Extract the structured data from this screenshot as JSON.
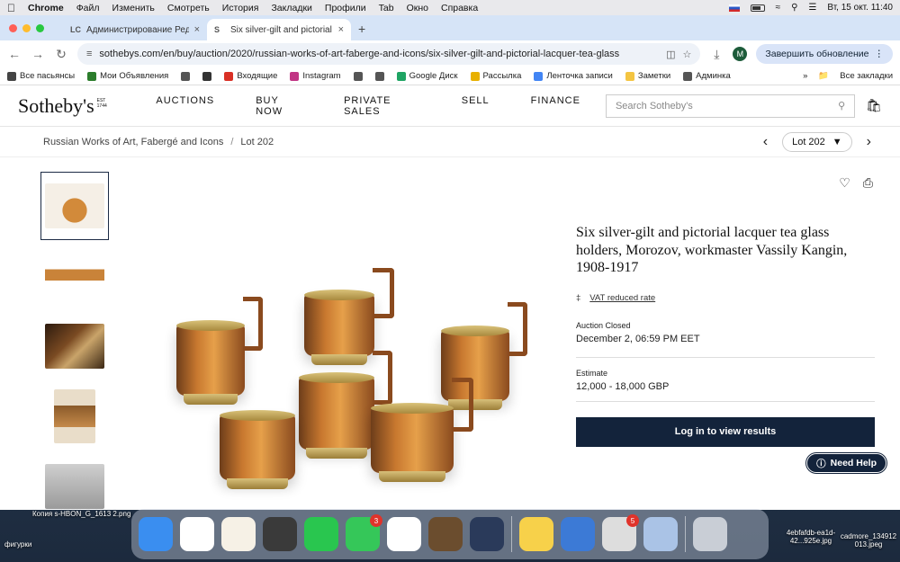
{
  "menubar": {
    "app": "Chrome",
    "items": [
      "Файл",
      "Изменить",
      "Смотреть",
      "История",
      "Закладки",
      "Профили",
      "Tab",
      "Окно",
      "Справка"
    ],
    "datetime": "Вт, 15 окт.  11:40"
  },
  "tabs": [
    {
      "favicon": "LC",
      "title": "Администрирование Редакт"
    },
    {
      "favicon": "S",
      "title": "Six silver-gilt and pictorial lac"
    }
  ],
  "toolbar": {
    "url": "sothebys.com/en/buy/auction/2020/russian-works-of-art-faberge-and-icons/six-silver-gilt-and-pictorial-lacquer-tea-glass",
    "profile_initial": "M",
    "update_label": "Завершить обновление"
  },
  "bookmarks": [
    {
      "label": "Все пасьянсы",
      "icon": "card-icon",
      "color": "#444"
    },
    {
      "label": "Мои Объявления",
      "icon": "ss-icon",
      "color": "#2c7d2c"
    },
    {
      "label": "",
      "icon": "globe-icon",
      "color": "#555"
    },
    {
      "label": "",
      "icon": "spade-icon",
      "color": "#333"
    },
    {
      "label": "Входящие",
      "icon": "gmail-icon",
      "color": "#d93025"
    },
    {
      "label": "Instagram",
      "icon": "instagram-icon",
      "color": "#c13584"
    },
    {
      "label": "",
      "icon": "globe-icon",
      "color": "#555"
    },
    {
      "label": "",
      "icon": "globe-icon",
      "color": "#555"
    },
    {
      "label": "Google Диск",
      "icon": "drive-icon",
      "color": "#1fa463"
    },
    {
      "label": "Рассылка",
      "icon": "mail-icon",
      "color": "#e8b000"
    },
    {
      "label": "Ленточка записи",
      "icon": "doc-icon",
      "color": "#4285f4"
    },
    {
      "label": "Заметки",
      "icon": "notes-icon",
      "color": "#f4c542"
    },
    {
      "label": "Админка",
      "icon": "lc-icon",
      "color": "#555"
    }
  ],
  "bookmarks_all": "Все закладки",
  "site": {
    "logo": "Sotheby's",
    "logo_est": "EST 1744",
    "nav": [
      "AUCTIONS",
      "BUY NOW",
      "PRIVATE SALES",
      "SELL",
      "FINANCE"
    ],
    "search_placeholder": "Search Sotheby's"
  },
  "breadcrumb": {
    "parent": "Russian Works of Art, Fabergé and Icons",
    "current": "Lot 202"
  },
  "lot_selector": "Lot 202",
  "lot": {
    "title": "Six silver-gilt and pictorial lacquer tea glass holders, Morozov, workmaster Vassily Kangin, 1908-1917",
    "vat_link": "VAT reduced rate",
    "status_label": "Auction Closed",
    "status_value": "December 2, 06:59 PM EET",
    "estimate_label": "Estimate",
    "estimate_value": "12,000 - 18,000 GBP",
    "cta": "Log in to view results"
  },
  "help_label": "Need Help",
  "dock": [
    {
      "name": "finder-icon",
      "color": "#3a8ef0",
      "badge": ""
    },
    {
      "name": "chrome-icon",
      "color": "#ffffff",
      "badge": ""
    },
    {
      "name": "pages-icon",
      "color": "#f6f1e6",
      "badge": ""
    },
    {
      "name": "calculator-icon",
      "color": "#3a3a3a",
      "badge": ""
    },
    {
      "name": "whatsapp-icon",
      "color": "#29c64f",
      "badge": ""
    },
    {
      "name": "messages-icon",
      "color": "#35c759",
      "badge": "3"
    },
    {
      "name": "photos-icon",
      "color": "#ffffff",
      "badge": ""
    },
    {
      "name": "figurine-icon",
      "color": "#6b4d2e",
      "badge": ""
    },
    {
      "name": "helmet-icon",
      "color": "#2a3a5a",
      "badge": ""
    },
    {
      "name": "notes-icon",
      "color": "#f7d14a",
      "badge": ""
    },
    {
      "name": "network-icon",
      "color": "#3c7ad6",
      "badge": ""
    },
    {
      "name": "printer-icon",
      "color": "#dddddd",
      "badge": "5"
    },
    {
      "name": "preview-icon",
      "color": "#aac3e6",
      "badge": ""
    },
    {
      "name": "trash-icon",
      "color": "#c9ced6",
      "badge": ""
    }
  ],
  "desktop_labels": {
    "left_top": "Копия s-HBON_G_1613 2.png",
    "left_bottom": "фигурки",
    "right_a": "4ebfafdb-ea1d-42...925e.jpg",
    "right_b": "cadmore_134912 013.jpeg"
  }
}
